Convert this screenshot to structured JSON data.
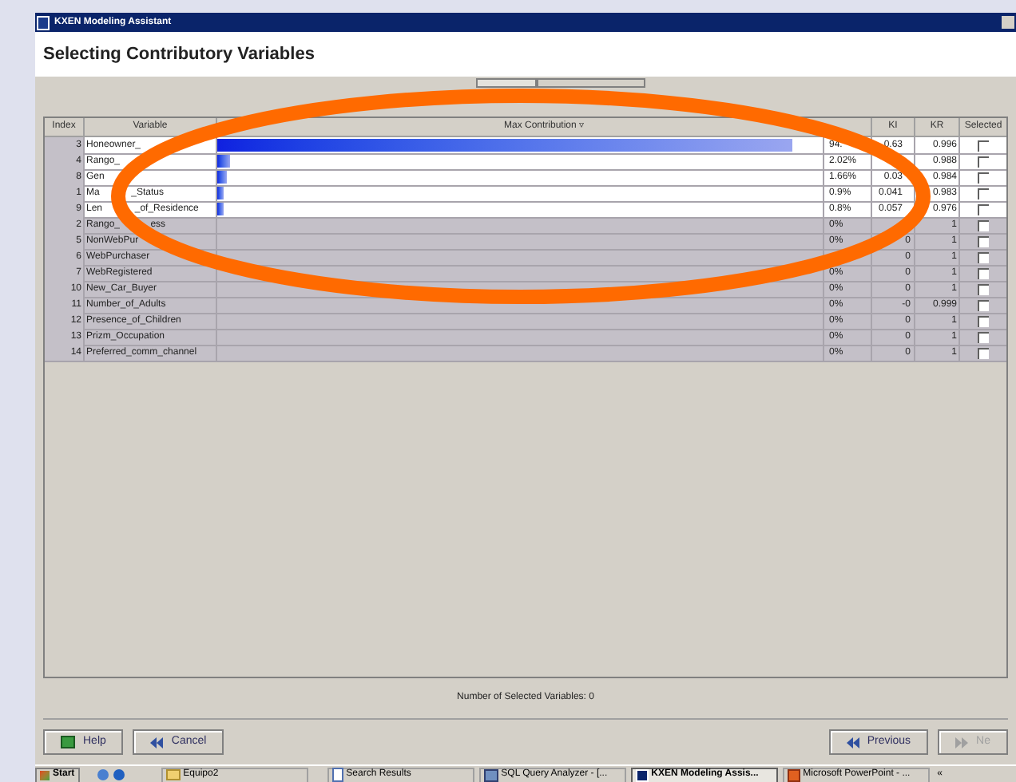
{
  "window": {
    "title": "KXEN Modeling Assistant"
  },
  "header": {
    "title": "Selecting Contributory Variables"
  },
  "table": {
    "columns": [
      "Index",
      "Variable",
      "Max Contribution",
      "KI",
      "KR",
      "Selected"
    ],
    "sort_mark": "▿",
    "rows": [
      {
        "index": "3",
        "variable": "Honeowner_",
        "level": 0.948,
        "contribution": "94.",
        "ki": "0.63",
        "kr": "0.996",
        "checked": false,
        "highlight": true
      },
      {
        "index": "4",
        "variable": "Rango_",
        "level": 0.02,
        "contribution": "2.02%",
        "kr": "0.988",
        "checked": false,
        "highlight": true
      },
      {
        "index": "8",
        "variable": "Gen",
        "level": 0.017,
        "contribution": "1.66%",
        "ki": "0.03",
        "kr": "0.984",
        "checked": false,
        "highlight": true
      },
      {
        "index": "1",
        "variable": "Ma",
        "variable_after": "_Status",
        "level": 0.009,
        "contribution": "0.9%",
        "ki": "0.041",
        "kr": "0.983",
        "checked": false,
        "highlight": true
      },
      {
        "index": "9",
        "variable": "Len",
        "variable_after": "_of_Residence",
        "level": 0.008,
        "contribution": "0.8%",
        "ki": "0.057",
        "kr": "0.976",
        "checked": false,
        "highlight": true
      },
      {
        "index": "2",
        "variable": "Rango_",
        "variable_after": "ess",
        "contribution": "0%",
        "kr": "1",
        "checked": false,
        "highlight": false
      },
      {
        "index": "5",
        "variable": "NonWebPur",
        "contribution": "0%",
        "ki": "0",
        "kr": "1",
        "checked": false,
        "highlight": false
      },
      {
        "index": "6",
        "variable": "WebPurchaser",
        "ki": "0",
        "kr": "1",
        "checked": false,
        "highlight": false
      },
      {
        "index": "7",
        "variable": "WebRegistered",
        "contribution": "0%",
        "ki": "0",
        "kr": "1",
        "checked": false,
        "highlight": false
      },
      {
        "index": "10",
        "variable": "New_Car_Buyer",
        "contribution": "0%",
        "ki": "0",
        "kr": "1",
        "checked": false,
        "highlight": false
      },
      {
        "index": "11",
        "variable": "Number_of_Adults",
        "contribution": "0%",
        "ki": "-0",
        "kr": "0.999",
        "checked": false,
        "highlight": false
      },
      {
        "index": "12",
        "variable": "Presence_of_Children",
        "contribution": "0%",
        "ki": "0",
        "kr": "1",
        "checked": false,
        "highlight": false
      },
      {
        "index": "13",
        "variable": "Prizm_Occupation",
        "contribution": "0%",
        "ki": "0",
        "kr": "1",
        "checked": false,
        "highlight": false
      },
      {
        "index": "14",
        "variable": "Preferred_comm_channel",
        "contribution": "0%",
        "ki": "0",
        "kr": "1",
        "checked": false,
        "highlight": false
      }
    ]
  },
  "status": "Number of Selected Variables: 0",
  "buttons": [
    {
      "label": "Help",
      "kind": "help",
      "disabled": false
    },
    {
      "label": "Cancel",
      "kind": "cancel",
      "disabled": false
    },
    {
      "label": "Previous",
      "kind": "previous",
      "disabled": false
    },
    {
      "label": "Ne",
      "kind": "next",
      "disabled": true
    }
  ],
  "taskbar": {
    "start": "Start",
    "tray": "«",
    "items": [
      {
        "label": "Equipo2",
        "kind": "folder",
        "selected": false
      },
      {
        "label": "Search Results",
        "kind": "page",
        "selected": false
      },
      {
        "label": "SQL Query Analyzer - [...",
        "kind": "sql",
        "selected": false
      },
      {
        "label": "KXEN Modeling Assis...",
        "kind": "kxen",
        "selected": true
      },
      {
        "label": "Microsoft PowerPoint - ...",
        "kind": "ppt",
        "selected": false
      }
    ]
  }
}
